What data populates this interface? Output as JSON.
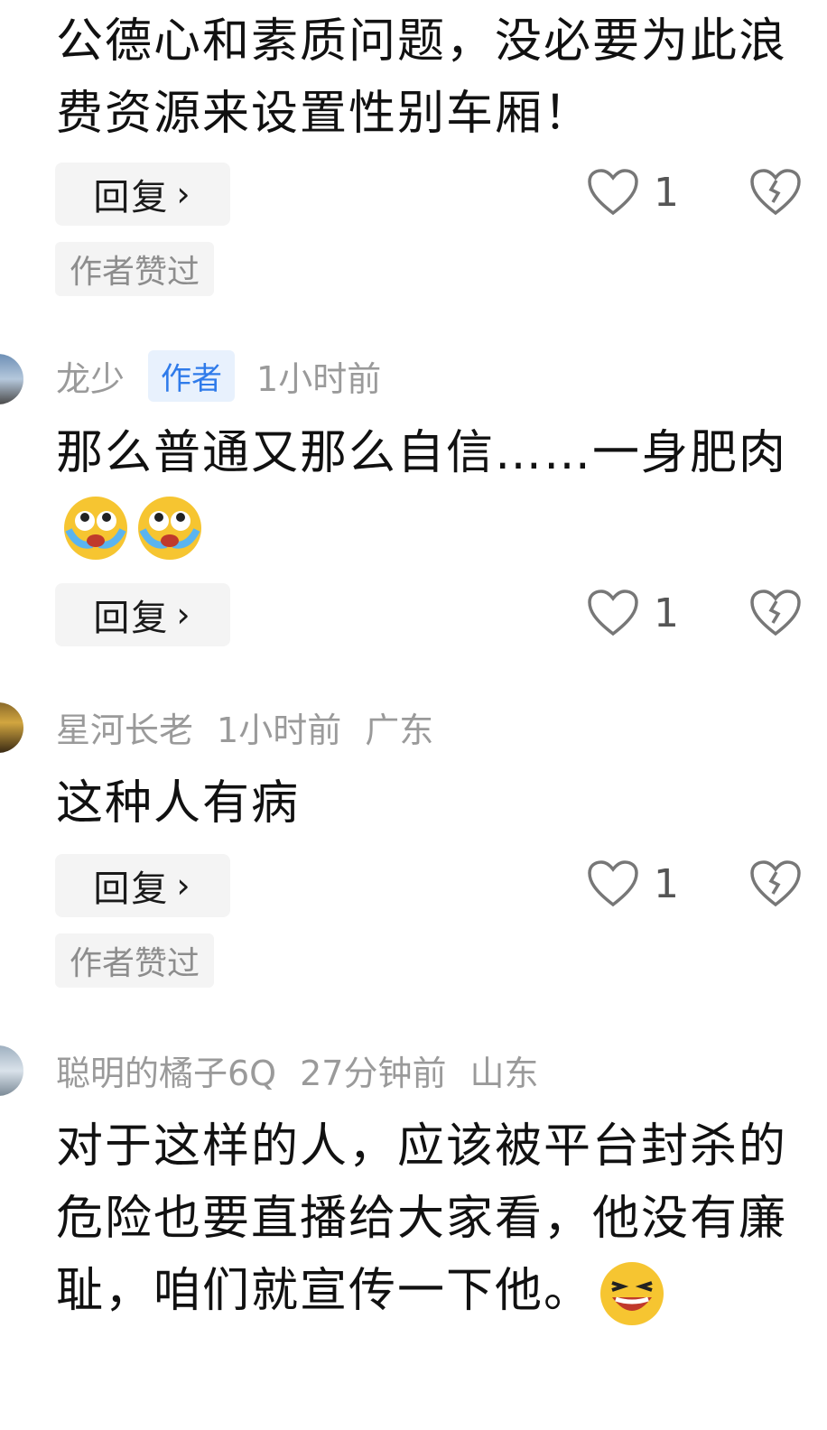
{
  "comments": [
    {
      "text": "公德心和素质问题，没必要为此浪费资源来设置性别车厢！",
      "reply_label": "回复",
      "likes": "1",
      "tag": "作者赞过"
    },
    {
      "user": "龙少",
      "badge": "作者",
      "time": "1小时前",
      "text": "那么普通又那么自信……一身肥肉",
      "reply_label": "回复",
      "likes": "1"
    },
    {
      "user": "星河长老",
      "time": "1小时前",
      "location": "广东",
      "text": "这种人有病",
      "reply_label": "回复",
      "likes": "1",
      "tag": "作者赞过"
    },
    {
      "user": "聪明的橘子6Q",
      "time": "27分钟前",
      "location": "山东",
      "text": "对于这样的人，应该被平台封杀的危险也要直播给大家看，他没有廉耻，咱们就宣传一下他。"
    }
  ],
  "icons": {
    "reply_chevron": "chevron-right-icon",
    "like": "heart-outline-icon",
    "dislike": "broken-heart-icon",
    "emoji_cry": "crying-emoji",
    "emoji_laugh": "laughing-emoji"
  }
}
